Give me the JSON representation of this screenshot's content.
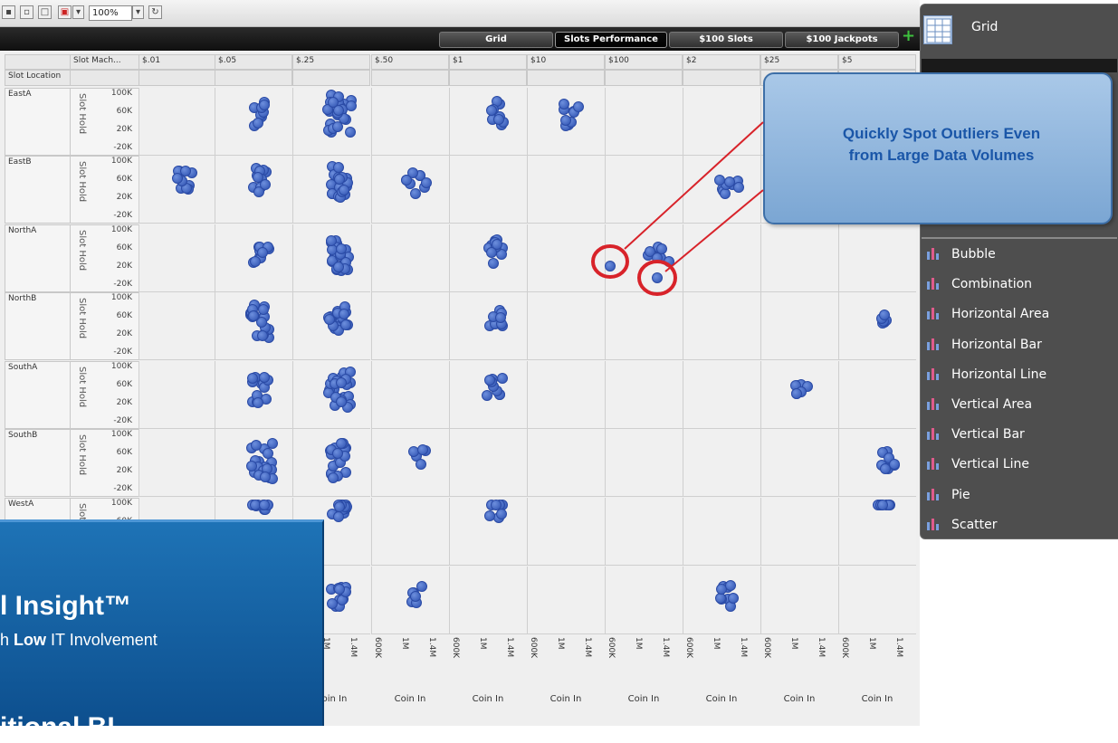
{
  "toolbar": {
    "zoom_value": "100%",
    "icons": [
      "save-icon",
      "open-icon",
      "page-icon",
      "pdf-icon",
      "refresh-icon"
    ]
  },
  "tabs": [
    {
      "label": "Grid",
      "active": false
    },
    {
      "label": "Slots Performance",
      "active": true
    },
    {
      "label": "$100 Slots",
      "active": false
    },
    {
      "label": "$100 Jackpots",
      "active": false
    }
  ],
  "grid": {
    "row_dim_header": "Slot Location",
    "col_dim_header": "Slot Mach...",
    "columns": [
      "$.01",
      "$.05",
      "$.25",
      "$.50",
      "$1",
      "$10",
      "$100",
      "$2",
      "$25",
      "$5"
    ],
    "rows": [
      "EastA",
      "EastB",
      "NorthA",
      "NorthB",
      "SouthA",
      "SouthB",
      "WestA"
    ],
    "y_title": "Slot Hold",
    "y_ticks": [
      "100K",
      "60K",
      "20K",
      "-20K"
    ],
    "x_ticks": [
      "600K",
      "1M",
      "1.4M"
    ],
    "x_title": "Coin In"
  },
  "side_panel": {
    "title": "Grid",
    "items": [
      "Bubble",
      "Combination",
      "Horizontal Area",
      "Horizontal Bar",
      "Horizontal Line",
      "Vertical Area",
      "Vertical Bar",
      "Vertical Line",
      "Pie",
      "Scatter"
    ]
  },
  "callout": {
    "line1": "Quickly Spot Outliers Even",
    "line2": "from Large Data Volumes"
  },
  "promo": {
    "title": "l Insight™",
    "sub_prefix": "h ",
    "sub_bold": "Low",
    "sub_suffix": " IT Involvement",
    "title2": "itional BI"
  },
  "colors": {
    "dot": "#2c50b0",
    "highlight_circle": "#d8232a",
    "callout_text": "#1a56a8"
  }
}
